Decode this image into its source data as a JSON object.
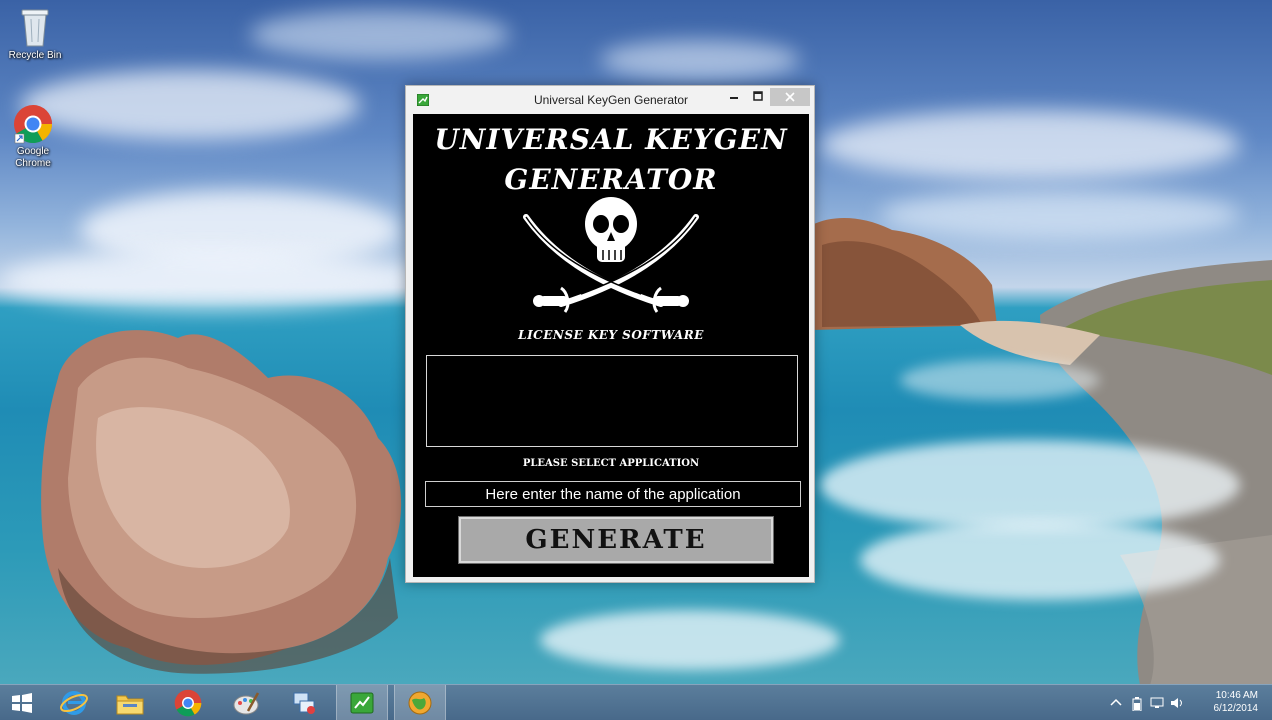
{
  "desktop": {
    "icons": [
      {
        "label": "Recycle Bin",
        "icon": "recycle-bin-icon"
      },
      {
        "label": "Google Chrome",
        "icon": "chrome-icon"
      }
    ]
  },
  "window": {
    "title": "Universal KeyGen Generator",
    "app_icon": "keygen-app-icon",
    "controls": {
      "minimize": "–",
      "maximize": "□",
      "close": "×"
    },
    "banner_title_line1": "UNIVERSAL KEYGEN",
    "banner_title_line2": "GENERATOR",
    "logo": "skull-crossed-swords-icon",
    "tagline": "LICENSE KEY SOFTWARE",
    "output_value": "",
    "select_label": "PLEASE SELECT APPLICATION",
    "app_input_placeholder": "Here enter the name of the application",
    "generate_label": "GENERATE"
  },
  "taskbar": {
    "start_icon": "windows-start-icon",
    "pinned": [
      {
        "name": "internet-explorer-icon",
        "active": false
      },
      {
        "name": "file-explorer-icon",
        "active": false
      },
      {
        "name": "chrome-icon",
        "active": false
      },
      {
        "name": "paint-icon",
        "active": false
      },
      {
        "name": "network-icon",
        "active": false
      },
      {
        "name": "keygen-app-icon",
        "active": true
      },
      {
        "name": "globe-app-icon",
        "active": true
      }
    ],
    "tray": {
      "clock_time": "10:46 AM",
      "clock_date": "6/12/2014"
    }
  },
  "colors": {
    "window_bg": "#000000",
    "button_bg": "#a9a9a9",
    "taskbar": "#48698a"
  }
}
